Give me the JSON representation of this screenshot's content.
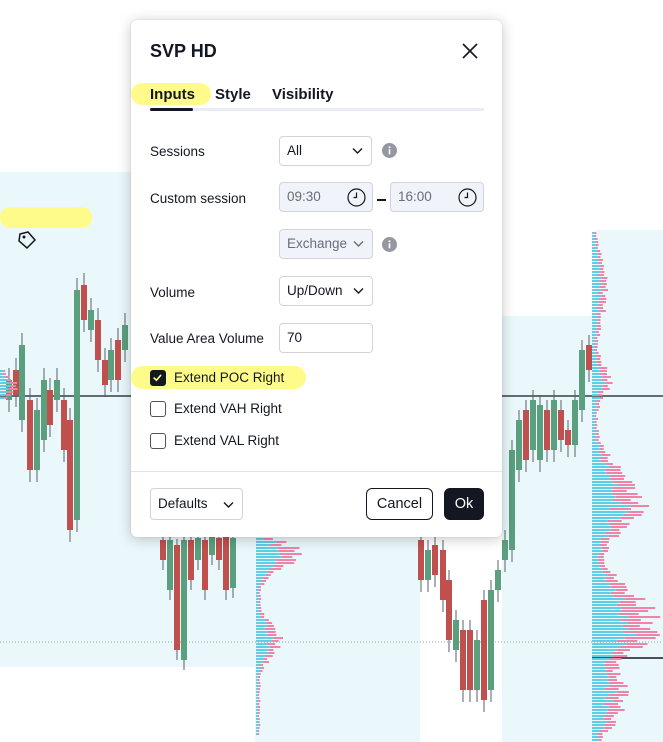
{
  "dialog": {
    "title": "SVP HD",
    "tabs": [
      {
        "label": "Inputs",
        "active": true
      },
      {
        "label": "Style",
        "active": false
      },
      {
        "label": "Visibility",
        "active": false
      }
    ],
    "fields": {
      "sessions": {
        "label": "Sessions",
        "value": "All"
      },
      "custom_session": {
        "label": "Custom session",
        "start": "09:30",
        "end": "16:00"
      },
      "timezone": {
        "value": "Exchange"
      },
      "volume": {
        "label": "Volume",
        "value": "Up/Down"
      },
      "value_area_volume": {
        "label": "Value Area Volume",
        "value": "70"
      }
    },
    "checkboxes": [
      {
        "label": "Extend POC Right",
        "checked": true
      },
      {
        "label": "Extend VAH Right",
        "checked": false
      },
      {
        "label": "Extend VAL Right",
        "checked": false
      }
    ],
    "footer": {
      "defaults_label": "Defaults",
      "cancel_label": "Cancel",
      "ok_label": "Ok"
    }
  },
  "colors": {
    "accent": "#131722",
    "highlight": "#fffb8a",
    "candle_up": "#5a9f7e",
    "candle_down": "#c0504d",
    "profile_up": "#5ccfe6",
    "profile_down": "#ee85a9",
    "session_bg": "#eaf8fb"
  },
  "icons": {
    "close": "close-icon",
    "chevron": "chevron-down-icon",
    "clock": "clock-icon",
    "info": "info-icon",
    "tag": "price-tag-icon"
  }
}
